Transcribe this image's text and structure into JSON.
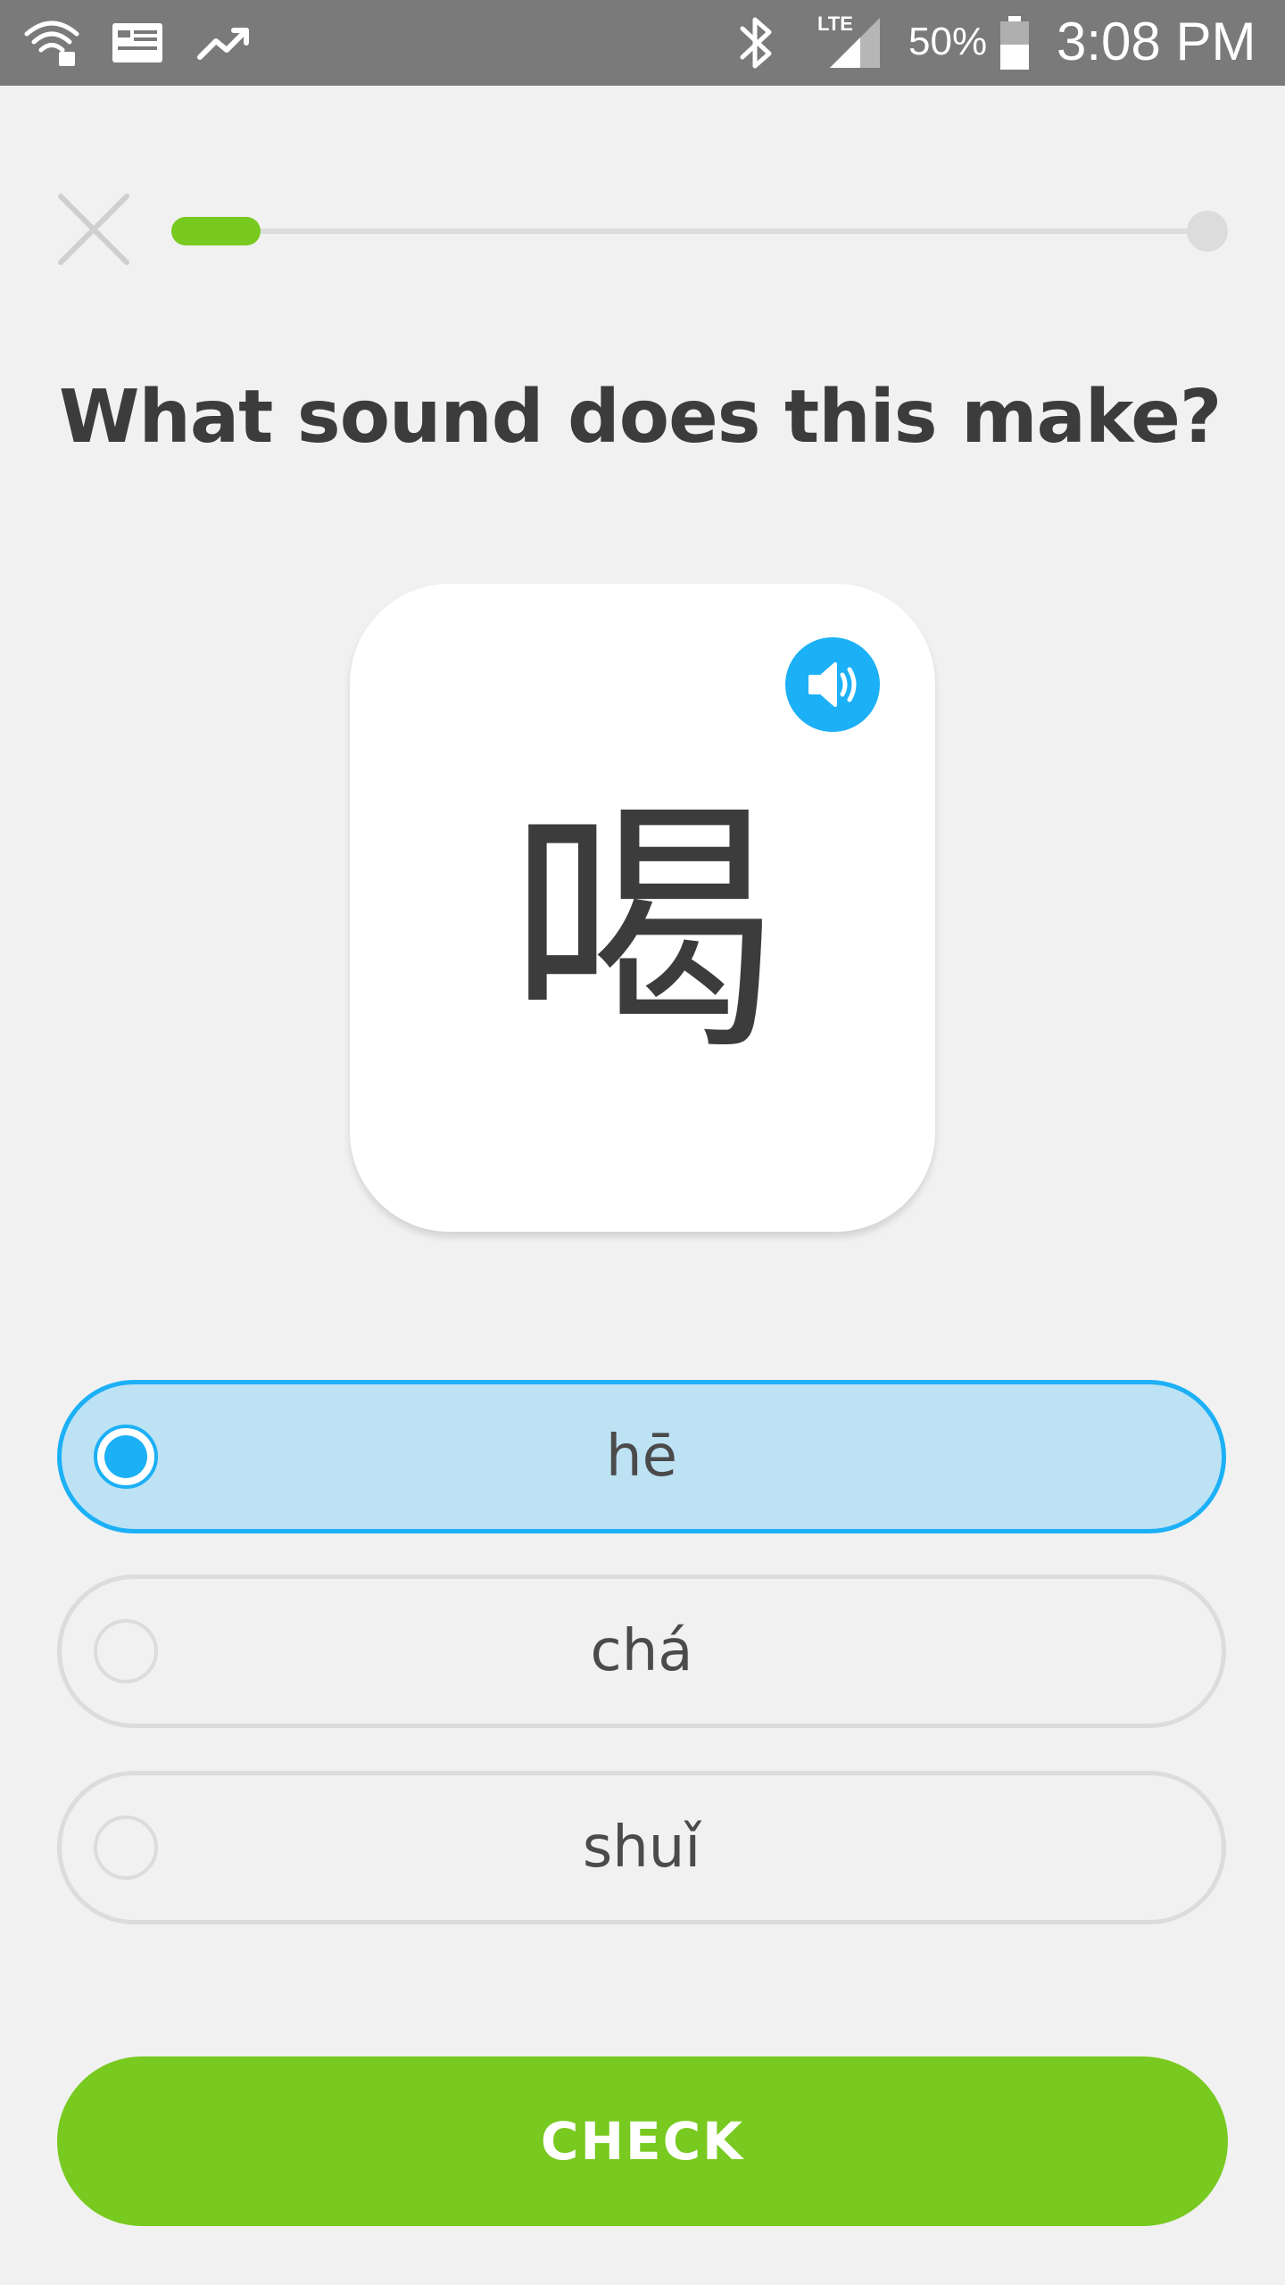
{
  "status_bar": {
    "battery_percent": "50%",
    "time": "3:08 PM",
    "network_label": "LTE",
    "icons": [
      "wifi-icon",
      "news-icon",
      "trending-icon",
      "bluetooth-icon",
      "signal-icon",
      "battery-icon"
    ]
  },
  "header": {
    "close_icon": "close-icon",
    "progress_fraction": 0.06
  },
  "question": {
    "prompt": "What sound does this make?"
  },
  "card": {
    "character": "喝",
    "audio_icon": "speaker-icon"
  },
  "options": [
    {
      "label": "hē",
      "selected": true
    },
    {
      "label": "chá",
      "selected": false
    },
    {
      "label": "shuǐ",
      "selected": false
    }
  ],
  "check_button": {
    "label": "CHECK"
  },
  "colors": {
    "accent_green": "#78c920",
    "accent_blue": "#1cb0f6",
    "selected_bg": "#bde2f4",
    "text_dark": "#3c3c3c"
  }
}
